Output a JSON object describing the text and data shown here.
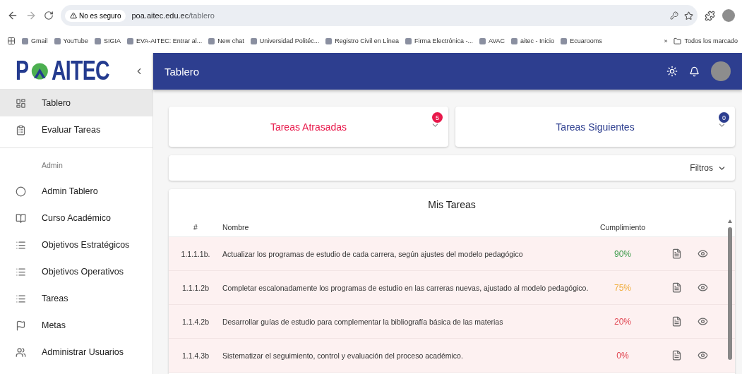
{
  "browser": {
    "security": "No es seguro",
    "url_host": "poa.aitec.edu.ec",
    "url_path": "/tablero",
    "bookmarks": [
      "Gmail",
      "YouTube",
      "SIGIA",
      "EVA-AITEC: Entrar al...",
      "New chat",
      "Universidad Politéc...",
      "Registro Civil en Línea",
      "Firma Electrónica -...",
      "AVAC",
      "aitec - Inicio",
      "Ecuarooms"
    ],
    "more": "»",
    "all_bookmarks": "Todos los marcado"
  },
  "logo": {
    "left": "P",
    "right": "AITEC"
  },
  "header": {
    "title": "Tablero"
  },
  "sidebar": {
    "items": [
      {
        "label": "Tablero",
        "selected": true
      },
      {
        "label": "Evaluar Tareas",
        "selected": false
      }
    ],
    "section": "Admin",
    "admin_items": [
      {
        "label": "Admin Tablero",
        "selected": false
      },
      {
        "label": "Curso Académico",
        "selected": false
      },
      {
        "label": "Objetivos Estratégicos",
        "selected": false
      },
      {
        "label": "Objetivos Operativos",
        "selected": false
      },
      {
        "label": "Tareas",
        "selected": false
      },
      {
        "label": "Metas",
        "selected": false
      },
      {
        "label": "Administrar Usuarios",
        "selected": false
      }
    ]
  },
  "summary_cards": [
    {
      "title": "Tareas Atrasadas",
      "count": "5",
      "color": "#e8194b"
    },
    {
      "title": "Tareas Siguientes",
      "count": "0",
      "color": "#2d3e8f"
    }
  ],
  "filters": {
    "label": "Filtros"
  },
  "table": {
    "title": "Mis Tareas",
    "columns": [
      "#",
      "Nombre",
      "Cumplimiento"
    ],
    "rows": [
      {
        "id": "1.1.1.1b.",
        "name": "Actualizar los programas de estudio de cada carrera, según ajustes del modelo pedagógico",
        "progress": "90%",
        "color": "#3c9a4a"
      },
      {
        "id": "1.1.1.2b",
        "name": "Completar escalonadamente los programas de estudio en las carreras nuevas, ajustado al modelo pedagógico.",
        "progress": "75%",
        "color": "#f0ad3c"
      },
      {
        "id": "1.1.4.2b",
        "name": "Desarrollar guías de estudio para complementar la bibliografía básica de las materias",
        "progress": "20%",
        "color": "#e0434f"
      },
      {
        "id": "1.1.4.3b",
        "name": "Sistematizar el seguimiento, control y evaluación del proceso académico.",
        "progress": "0%",
        "color": "#e0434f"
      }
    ]
  }
}
